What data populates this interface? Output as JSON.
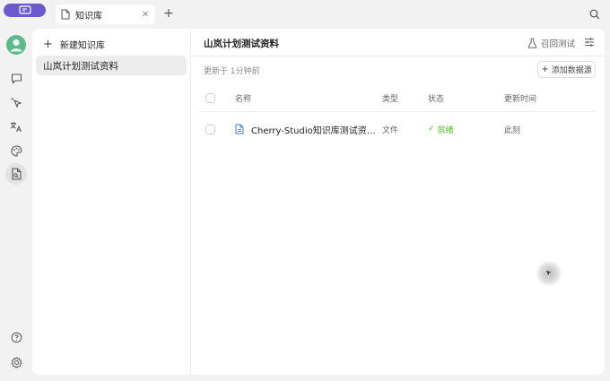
{
  "tabs": [
    {
      "label": "知识库",
      "icon": "file-text-icon"
    }
  ],
  "nav": {
    "items": [
      {
        "name": "assistants",
        "icon": "message-square-icon"
      },
      {
        "name": "agents",
        "icon": "pointer-sparkle-icon"
      },
      {
        "name": "translate",
        "icon": "languages-icon"
      },
      {
        "name": "paintings",
        "icon": "palette-icon"
      },
      {
        "name": "knowledge",
        "icon": "file-search-icon",
        "active": true
      }
    ],
    "bottom": [
      {
        "name": "help",
        "icon": "help-circle-icon"
      },
      {
        "name": "settings",
        "icon": "gear-icon"
      }
    ]
  },
  "sidebar": {
    "new_label": "新建知识库",
    "items": [
      {
        "label": "山岚计划测试资料",
        "selected": true
      }
    ]
  },
  "main": {
    "title": "山岚计划测试资料",
    "recall_test_label": "召回测试",
    "updated_label": "更新于 1分钟前",
    "add_source_label": "添加数据源",
    "columns": {
      "name": "名称",
      "type": "类型",
      "status": "状态",
      "updated": "更新时间"
    },
    "rows": [
      {
        "name": "Cherry-Studio知识库测试资…",
        "type": "文件",
        "status": "就绪",
        "updated": "此刻"
      }
    ]
  },
  "colors": {
    "accent": "#6a5acd",
    "status_ready": "#52c41a",
    "avatar": "#5bb98c"
  }
}
